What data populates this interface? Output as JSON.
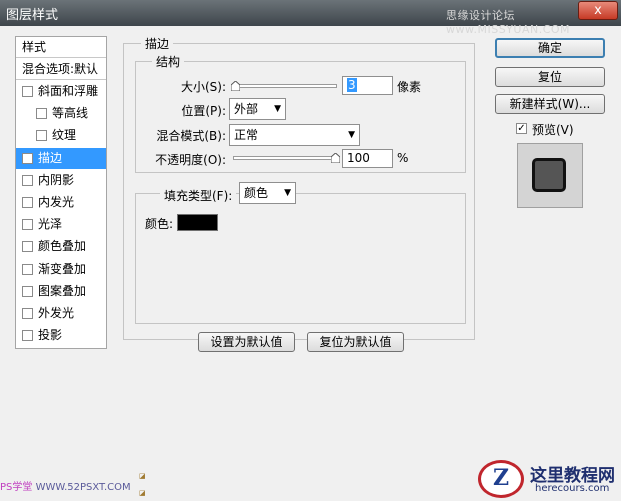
{
  "window": {
    "title": "图层样式",
    "watermark_top": "思缘设计论坛 www.MISSYUAN.COM",
    "close_glyph": "x"
  },
  "style_list": {
    "header": "样式",
    "blend_options": "混合选项:默认",
    "items": [
      {
        "label": "斜面和浮雕",
        "checked": false
      },
      {
        "label": "等高线",
        "checked": false,
        "indent": true
      },
      {
        "label": "纹理",
        "checked": false,
        "indent": true
      },
      {
        "label": "描边",
        "checked": true,
        "selected": true
      },
      {
        "label": "内阴影",
        "checked": false
      },
      {
        "label": "内发光",
        "checked": false
      },
      {
        "label": "光泽",
        "checked": false
      },
      {
        "label": "颜色叠加",
        "checked": false
      },
      {
        "label": "渐变叠加",
        "checked": false
      },
      {
        "label": "图案叠加",
        "checked": false
      },
      {
        "label": "外发光",
        "checked": false
      },
      {
        "label": "投影",
        "checked": false
      }
    ]
  },
  "stroke": {
    "group_title": "描边",
    "structure_title": "结构",
    "size_label": "大小(S):",
    "size_value": "3",
    "size_unit": "像素",
    "position_label": "位置(P):",
    "position_value": "外部",
    "blend_label": "混合模式(B):",
    "blend_value": "正常",
    "opacity_label": "不透明度(O):",
    "opacity_value": "100",
    "opacity_unit": "%",
    "opacity_fraction": 1.0,
    "fill_type_label": "填充类型(F):",
    "fill_type_value": "颜色",
    "color_label": "颜色:",
    "color_hex": "#000000"
  },
  "buttons": {
    "ok": "确定",
    "reset": "复位",
    "new_style": "新建样式(W)...",
    "preview_label": "预览(V)",
    "preview_checked": true,
    "set_default": "设置为默认值",
    "reset_default": "复位为默认值"
  },
  "watermarks": {
    "bottom_left_brand": "PS学堂",
    "bottom_left_url": "WWW.52PSXT.COM",
    "logo_glyph": "Z",
    "logo_text": "这里教程网",
    "logo_url": "herecours.com"
  }
}
